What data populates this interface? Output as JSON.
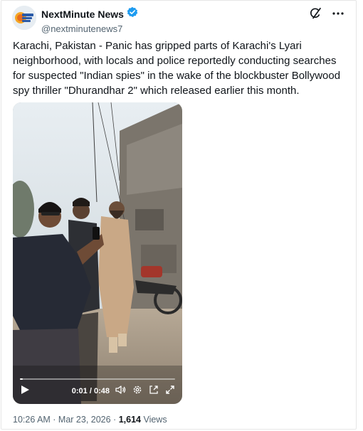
{
  "author": {
    "name": "NextMinute News",
    "handle": "@nextminutenews7",
    "verified": true
  },
  "post": {
    "text": "Karachi, Pakistan - Panic has gripped parts of Karachi's Lyari neighborhood, with locals and police reportedly conducting searches for suspected \"Indian spies\" in the wake of the blockbuster Bollywood spy thriller \"Dhurandhar 2\" which released earlier this month."
  },
  "video": {
    "current_time": "0:01",
    "separator": " / ",
    "duration": "0:48",
    "progress": 0.02
  },
  "meta": {
    "timestamp": "10:26 AM · Mar 23, 2026 · ",
    "views_count": "1,614",
    "views_label": " Views"
  },
  "colors": {
    "verified": "#1d9bf0",
    "secondary_text": "#536471",
    "text": "#0f1419"
  },
  "icons": {
    "top_right": [
      "grok-icon",
      "more-icon"
    ],
    "video_controls": [
      "play-icon",
      "volume-icon",
      "settings-icon",
      "popout-icon",
      "fullscreen-icon"
    ]
  }
}
